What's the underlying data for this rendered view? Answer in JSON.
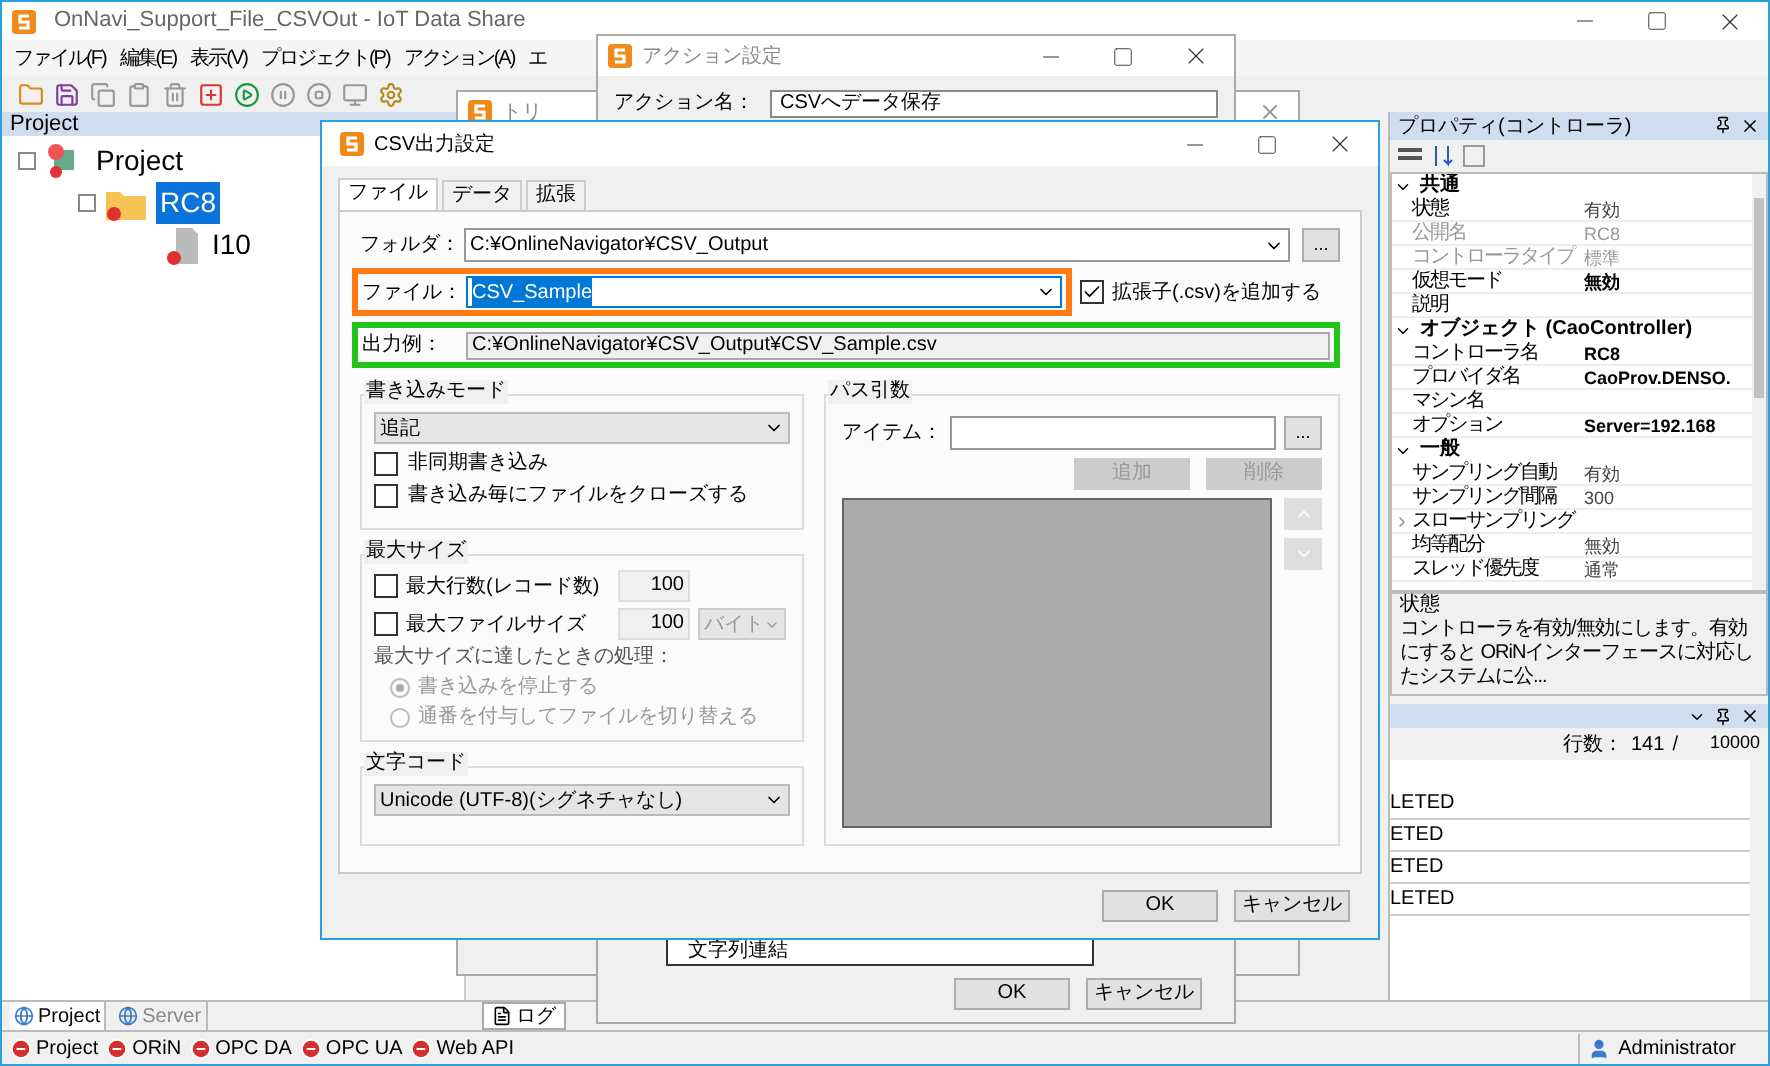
{
  "main_window": {
    "title": "OnNavi_Support_File_CSVOut - IoT Data Share",
    "menu": [
      "ファイル(F)",
      "編集(E)",
      "表示(V)",
      "プロジェクト(P)",
      "アクション(A)",
      "エ"
    ]
  },
  "project_panel": {
    "title": "Project",
    "tree": [
      {
        "label": "Project",
        "selected": false,
        "children": [
          {
            "label": "RC8",
            "selected": true,
            "children": [
              {
                "label": "I10",
                "selected": false
              }
            ]
          }
        ]
      }
    ]
  },
  "bottom_tabs": [
    {
      "label": "Project",
      "selected": true
    },
    {
      "label": "Server",
      "selected": false
    }
  ],
  "center_tab": "ログ",
  "properties_panel": {
    "title": "プロパティ(コントローラ)",
    "categories": [
      {
        "label": "共通",
        "expanded": true,
        "rows": [
          {
            "name": "状態",
            "value": "有効",
            "disabled": false,
            "modified": false
          },
          {
            "name": "公開名",
            "value": "RC8",
            "disabled": true,
            "modified": false
          },
          {
            "name": "コントローラタイプ",
            "value": "標準",
            "disabled": true,
            "modified": false
          },
          {
            "name": "仮想モード",
            "value": "無効",
            "disabled": false,
            "modified": true
          },
          {
            "name": "説明",
            "disabled": false
          }
        ]
      },
      {
        "label": "オブジェクト (CaoController)",
        "expanded": true,
        "rows": [
          {
            "name": "コントローラ名",
            "value": "RC8",
            "disabled": false,
            "modified": true
          },
          {
            "name": "プロバイダ名",
            "value": "CaoProv.DENSO.",
            "disabled": false,
            "modified": true
          },
          {
            "name": "マシン名",
            "disabled": false
          },
          {
            "name": "オプション",
            "value": "Server=192.168",
            "disabled": false,
            "modified": true
          }
        ]
      },
      {
        "label": "一般",
        "expanded": true,
        "rows": [
          {
            "name": "サンプリング自動",
            "value": "有効",
            "disabled": false,
            "modified": false
          },
          {
            "name": "サンプリング間隔",
            "value": "300",
            "disabled": false,
            "modified": false
          },
          {
            "name": "スローサンプリング",
            "disabled": false,
            "expandable": true
          },
          {
            "name": "均等配分",
            "value": "無効",
            "disabled": false,
            "modified": false
          },
          {
            "name": "スレッド優先度",
            "value": "通常",
            "disabled": false,
            "modified": false
          }
        ]
      }
    ],
    "description_title": "状態",
    "description": "コントローラを有効/無効にします。有効にすると ORiNインターフェースに対応したシステムに公..."
  },
  "log_panel": {
    "count_label": "行数：",
    "count": "141",
    "separator": "/",
    "max": "10000",
    "rows": [
      "LETED",
      "ETED",
      "ETED",
      "LETED"
    ]
  },
  "status_bar": {
    "items": [
      "Project",
      "ORiN",
      "OPC DA",
      "OPC UA",
      "Web API"
    ],
    "user": "Administrator"
  },
  "trigger_window": {
    "title": "トリ"
  },
  "action_dialog": {
    "title": "アクション設定",
    "name_label": "アクション名：",
    "name_value": "CSVへデータ保存",
    "list_item": "文字列連結",
    "buttons": [
      "OK",
      "キャンセル"
    ]
  },
  "csv_dialog": {
    "title": "CSV出力設定",
    "tabs": [
      {
        "label": "ファイル",
        "selected": true
      },
      {
        "label": "データ",
        "selected": false
      },
      {
        "label": "拡張",
        "selected": false
      }
    ],
    "folder": {
      "label": "フォルダ：",
      "value": "C:¥OnlineNavigator¥CSV_Output",
      "browse": "..."
    },
    "file": {
      "label": "ファイル：",
      "value": "CSV_Sample",
      "color": "#ff7a10"
    },
    "add_extension": {
      "label": "拡張子(.csv)を追加する",
      "checked": true
    },
    "output_example": {
      "label": "出力例：",
      "value": "C:¥OnlineNavigator¥CSV_Output¥CSV_Sample.csv",
      "color": "#22c41a"
    },
    "write_mode": {
      "title": "書き込みモード",
      "mode": "追記",
      "options": [
        {
          "label": "非同期書き込み",
          "checked": false
        },
        {
          "label": "書き込み毎にファイルをクローズする",
          "checked": false
        }
      ]
    },
    "max_size": {
      "title": "最大サイズ",
      "limits": [
        {
          "label": "最大行数(レコード数)",
          "checked": false,
          "value": "100"
        },
        {
          "label": "最大ファイルサイズ",
          "checked": false,
          "value": "100",
          "unit": "バイト"
        }
      ],
      "on_limit_label": "最大サイズに達したときの処理：",
      "actions": [
        {
          "label": "書き込みを停止する",
          "selected": true,
          "disabled": true
        },
        {
          "label": "通番を付与してファイルを切り替える",
          "selected": false,
          "disabled": true
        }
      ]
    },
    "encoding": {
      "title": "文字コード",
      "value": "Unicode (UTF-8)(シグネチャなし)"
    },
    "path_args": {
      "title": "パス引数",
      "item_label": "アイテム：",
      "browse": "...",
      "buttons": [
        {
          "label": "追加",
          "disabled": true
        },
        {
          "label": "削除",
          "disabled": true
        }
      ],
      "move_disabled": true
    },
    "buttons": [
      "OK",
      "キャンセル"
    ]
  }
}
